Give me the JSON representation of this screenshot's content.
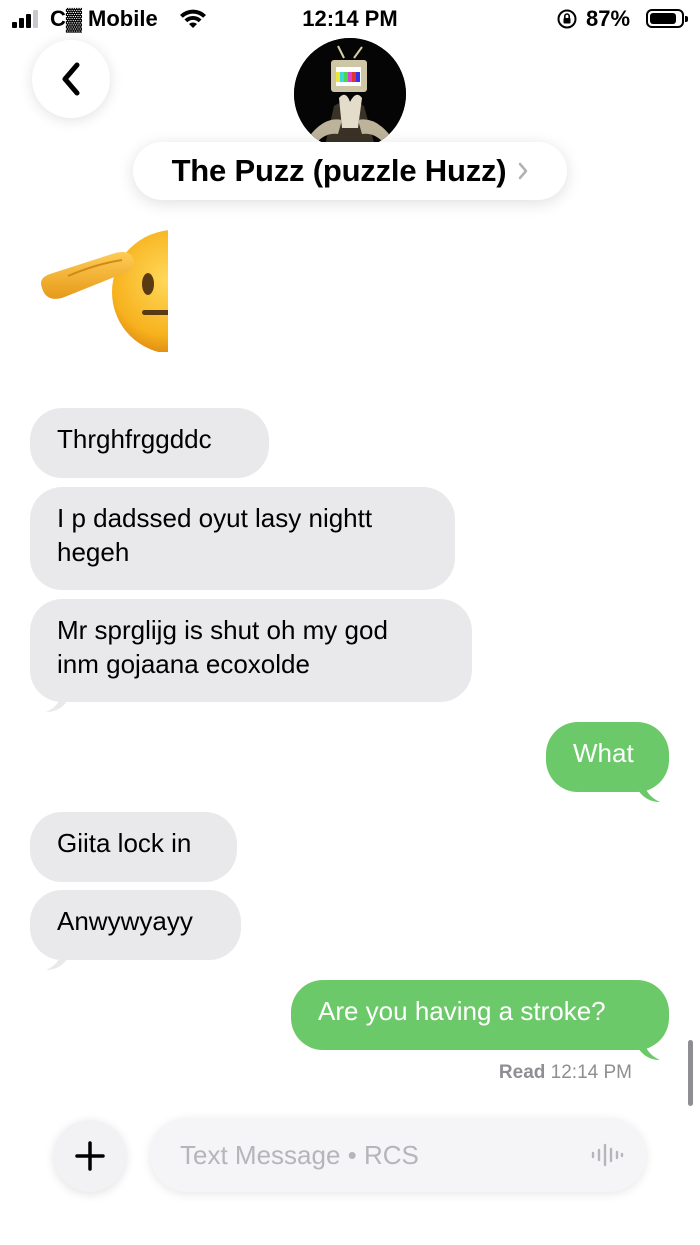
{
  "status_bar": {
    "carrier": "C▓ Mobile",
    "time": "12:14 PM",
    "battery": "87%",
    "battery_level": 0.87
  },
  "header": {
    "contact_name": "The Puzz (puzzle Huzz)"
  },
  "messages": [
    {
      "direction": "incoming",
      "type": "emoji",
      "icon": "saluting-face-emoji"
    },
    {
      "direction": "incoming",
      "text_lines": [
        "Thrghfrggddc"
      ]
    },
    {
      "direction": "incoming",
      "text_lines": [
        "I p dadssed oyut lasy nightt",
        "hegeh"
      ]
    },
    {
      "direction": "incoming",
      "text_lines": [
        "Mr sprglijg is shut oh my god",
        "inm gojaana ecoxolde"
      ]
    },
    {
      "direction": "outgoing",
      "text_lines": [
        "What"
      ]
    },
    {
      "direction": "incoming",
      "text_lines": [
        "Giita lock in"
      ]
    },
    {
      "direction": "incoming",
      "text_lines": [
        "Anwywyayy"
      ]
    },
    {
      "direction": "outgoing",
      "text_lines": [
        "Are you having a stroke?"
      ]
    }
  ],
  "read_receipt": {
    "label": "Read",
    "time": "12:14 PM"
  },
  "compose": {
    "placeholder": "Text Message • RCS"
  },
  "colors": {
    "incoming_bubble": "#e9e9eb",
    "outgoing_bubble": "#6cc96a",
    "meta_text": "#8e8e93"
  }
}
